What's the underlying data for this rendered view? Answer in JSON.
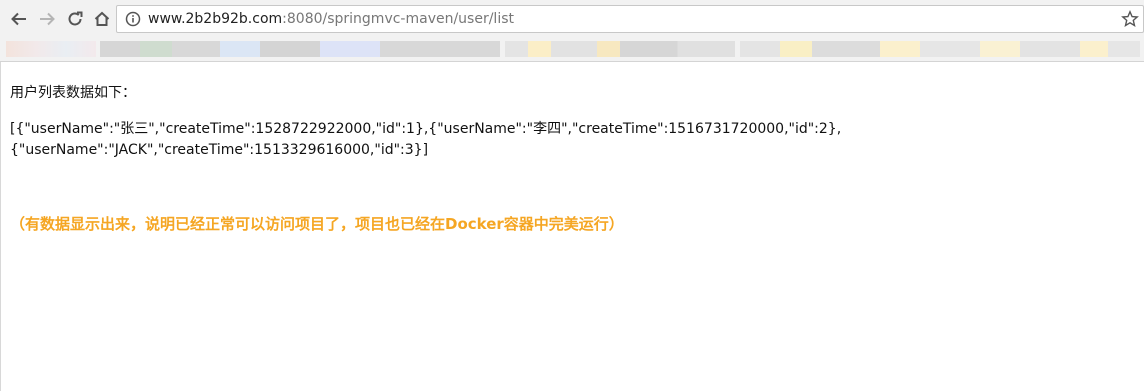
{
  "browser": {
    "back_icon": "arrow-left-icon",
    "forward_icon": "arrow-right-icon",
    "reload_icon": "reload-icon",
    "home_icon": "home-icon",
    "url_host": "www.2b2b92b.com",
    "url_rest": ":8080/springmvc-maven/user/list",
    "bookmark_icon": "star-icon"
  },
  "page": {
    "heading": "用户列表数据如下：",
    "json_line1": "[{\"userName\":\"张三\",\"createTime\":1528722922000,\"id\":1},{\"userName\":\"李四\",\"createTime\":1516731720000,\"id\":2},",
    "json_line2": "{\"userName\":\"JACK\",\"createTime\":1513329616000,\"id\":3}]",
    "note": "（有数据显示出来，说明已经正常可以访问项目了，项目也已经在Docker容器中完美运行）"
  },
  "colors": {
    "note": "#f5a623",
    "toolbar": "#f2f2f2"
  }
}
